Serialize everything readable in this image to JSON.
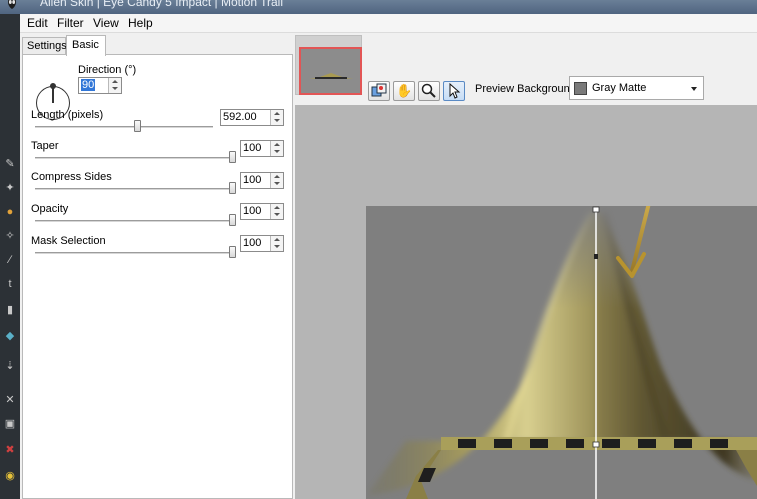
{
  "window": {
    "title": "Alien Skin | Eye Candy 5 Impact | Motion Trail"
  },
  "menu": {
    "items": [
      "Edit",
      "Filter",
      "View",
      "Help"
    ]
  },
  "tabs": {
    "settings_label": "Settings",
    "basic_label": "Basic"
  },
  "controls": {
    "direction": {
      "label": "Direction (°)",
      "value": "90"
    },
    "length": {
      "label": "Length (pixels)",
      "value": "592.00"
    },
    "taper": {
      "label": "Taper",
      "value": "100"
    },
    "compress_sides": {
      "label": "Compress Sides",
      "value": "100"
    },
    "opacity": {
      "label": "Opacity",
      "value": "100"
    },
    "mask_selection": {
      "label": "Mask Selection",
      "value": "100"
    }
  },
  "slider_levels": {
    "length": 0.58,
    "taper": 1.0,
    "compress_sides": 1.0,
    "opacity": 1.0,
    "mask_selection": 1.0
  },
  "toolbar": {
    "preview_background_label": "Preview Background:",
    "preview_background_value": "Gray Matte",
    "tools": [
      "before-after-icon",
      "hand-icon",
      "zoom-icon",
      "pointer-icon"
    ]
  },
  "colors": {
    "accent_selection": "#e25555",
    "gold_arrow": "#c7a23e",
    "preview_bg": "#7f7f7f",
    "workspace_bg": "#b5b5b5"
  }
}
